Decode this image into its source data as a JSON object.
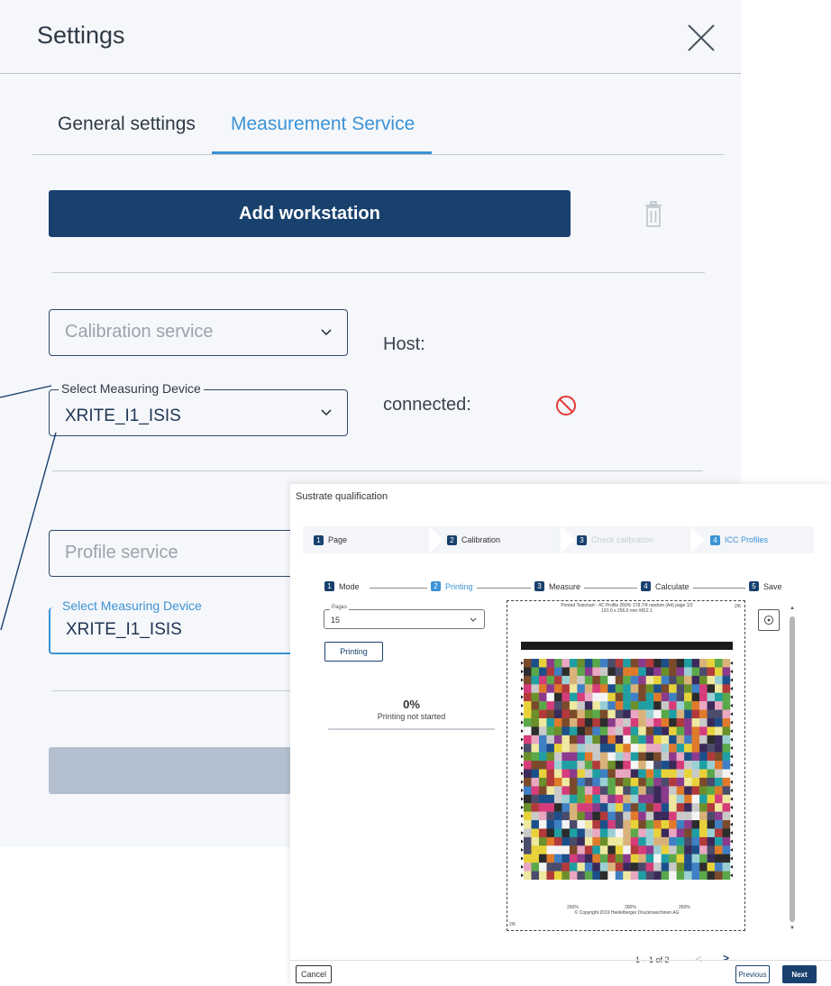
{
  "settings": {
    "title": "Settings",
    "tabs": [
      {
        "label": "General settings",
        "active": false
      },
      {
        "label": "Measurement Service",
        "active": true
      }
    ],
    "add_workstation_label": "Add workstation",
    "calibration": {
      "service_placeholder": "Calibration service",
      "device_label": "Select Measuring Device",
      "device_value": "XRITE_I1_ISIS",
      "host_label": "Host:",
      "connected_label": "connected:"
    },
    "profile": {
      "service_placeholder": "Profile service",
      "device_label": "Select Measuring Device",
      "device_value": "XRITE_I1_ISIS"
    },
    "colors": {
      "primary": "#19416e",
      "accent": "#3c93d6",
      "error": "#e53935",
      "disabled": "#b2bfce"
    }
  },
  "dialog": {
    "title": "Sustrate qualification",
    "steps": [
      {
        "num": "1",
        "label": "Page"
      },
      {
        "num": "2",
        "label": "Calibration"
      },
      {
        "num": "3",
        "label": "Check calibration"
      },
      {
        "num": "4",
        "label": "ICC Profiles"
      }
    ],
    "substeps": [
      {
        "num": "1",
        "label": "Mode"
      },
      {
        "num": "2",
        "label": "Printing"
      },
      {
        "num": "3",
        "label": "Measure"
      },
      {
        "num": "4",
        "label": "Calculate"
      },
      {
        "num": "5",
        "label": "Save"
      }
    ],
    "pages": {
      "label": "Pages",
      "value": "15"
    },
    "printing_button": "Printing",
    "progress": {
      "percent_text": "0%",
      "status": "Printing not started",
      "value": 0
    },
    "preview": {
      "title_line1": "Printed Testchart - 4C Profile 260% 1T8.7/4 random (A4) page 1/2",
      "title_line2": "191.0 x 256.0 mm  #812.1",
      "corner_label": "2/6",
      "pct_labels": [
        "260%",
        "260%",
        "260%"
      ],
      "copyright": "© Copyright 2019  Heidelberger Druckmaschinen AG",
      "bottom_corner": "2/6"
    },
    "pagination": "1 – 1 of 2",
    "cancel_label": "Cancel",
    "previous_label": "Previous",
    "next_label": "Next"
  }
}
